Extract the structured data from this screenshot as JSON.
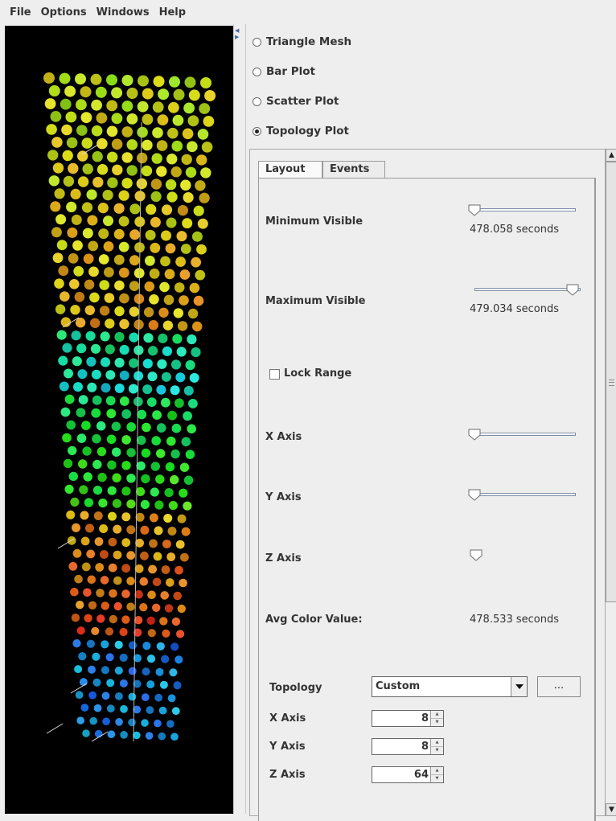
{
  "menu": [
    "File",
    "Options",
    "Windows",
    "Help"
  ],
  "plot_types": [
    {
      "label": "Triangle Mesh",
      "selected": false
    },
    {
      "label": "Bar Plot",
      "selected": false
    },
    {
      "label": "Scatter Plot",
      "selected": false
    },
    {
      "label": "Topology Plot",
      "selected": true
    }
  ],
  "tabs": [
    {
      "label": "Layout",
      "active": true
    },
    {
      "label": "Events",
      "active": false
    }
  ],
  "layout": {
    "min_visible": {
      "label": "Minimum Visible",
      "value_text": "478.058 seconds",
      "slider_fraction": 0.0
    },
    "max_visible": {
      "label": "Maximum Visible",
      "value_text": "479.034 seconds",
      "slider_fraction": 1.0
    },
    "lock_range": {
      "label": "Lock Range",
      "checked": false
    },
    "x_axis": {
      "label": "X Axis",
      "slider_fraction": 0.0
    },
    "y_axis": {
      "label": "Y Axis",
      "slider_fraction": 0.0
    },
    "z_axis": {
      "label": "Z Axis",
      "slider_fraction": 0.0
    },
    "avg_color": {
      "label": "Avg Color Value:",
      "value_text": "478.533 seconds"
    },
    "topology": {
      "label": "Topology",
      "selected": "Custom",
      "button_label": "..."
    },
    "dims": [
      {
        "label": "X Axis",
        "value": "8"
      },
      {
        "label": "Y Axis",
        "value": "8"
      },
      {
        "label": "Z Axis",
        "value": "64"
      }
    ]
  },
  "icons": [
    "split-left-arrow-icon",
    "split-right-arrow-icon",
    "scroll-up-icon",
    "scroll-down-icon",
    "dropdown-arrow-icon",
    "spinner-up-icon",
    "spinner-down-icon"
  ],
  "colors": {
    "viewport_bg": "#000000",
    "panel_bg": "#eeeeee",
    "slider_track": "#7d8ea8"
  }
}
